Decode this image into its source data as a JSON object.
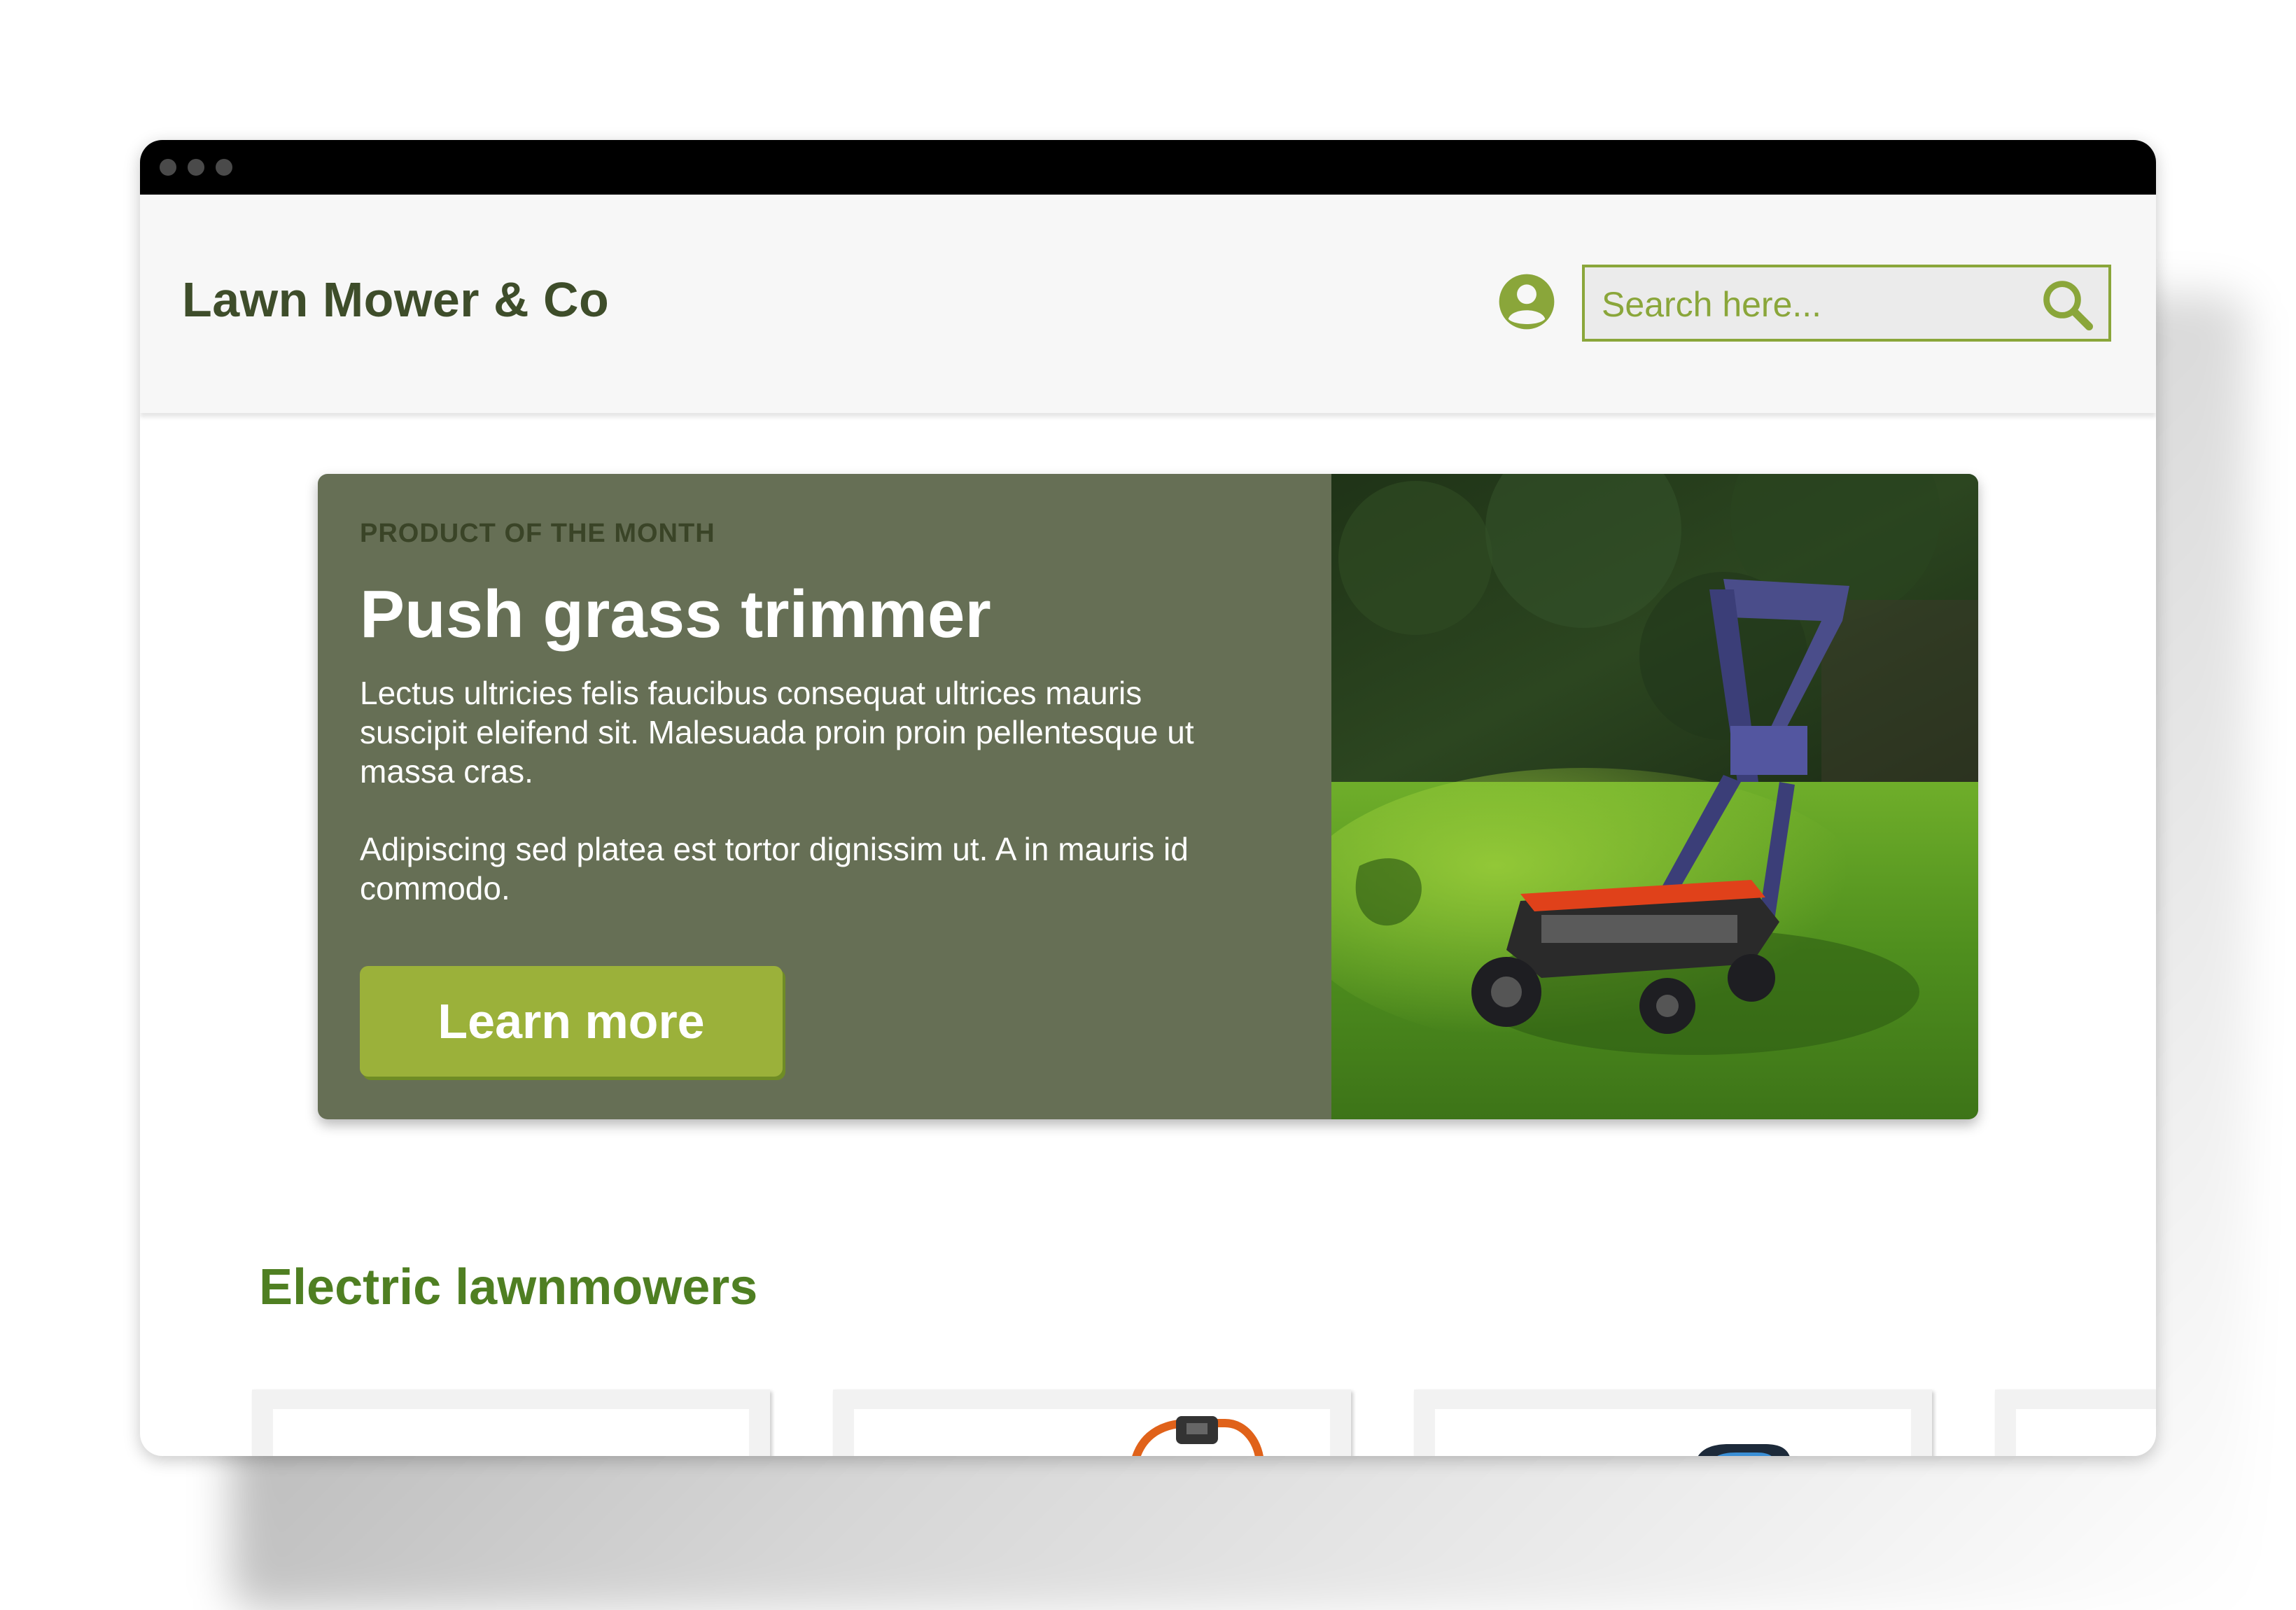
{
  "header": {
    "brand": "Lawn Mower & Co",
    "search_placeholder": "Search here...",
    "account_icon": "user-circle-icon",
    "search_icon": "search-icon"
  },
  "hero": {
    "eyebrow": "PRODUCT OF THE MONTH",
    "title": "Push grass trimmer",
    "paragraph1": "Lectus ultricies felis faucibus consequat ultrices mauris suscipit eleifend sit. Malesuada proin proin pellentesque ut massa cras.",
    "paragraph2": "Adipiscing sed platea est tortor dignissim ut. A in mauris id commodo.",
    "cta_label": "Learn more"
  },
  "section": {
    "title": "Electric lawnmowers"
  },
  "colors": {
    "brand_text": "#3e4d2a",
    "accent": "#8aa63a",
    "button": "#9bb13a",
    "hero_panel": "#666f55",
    "section_title": "#4f7f22"
  }
}
